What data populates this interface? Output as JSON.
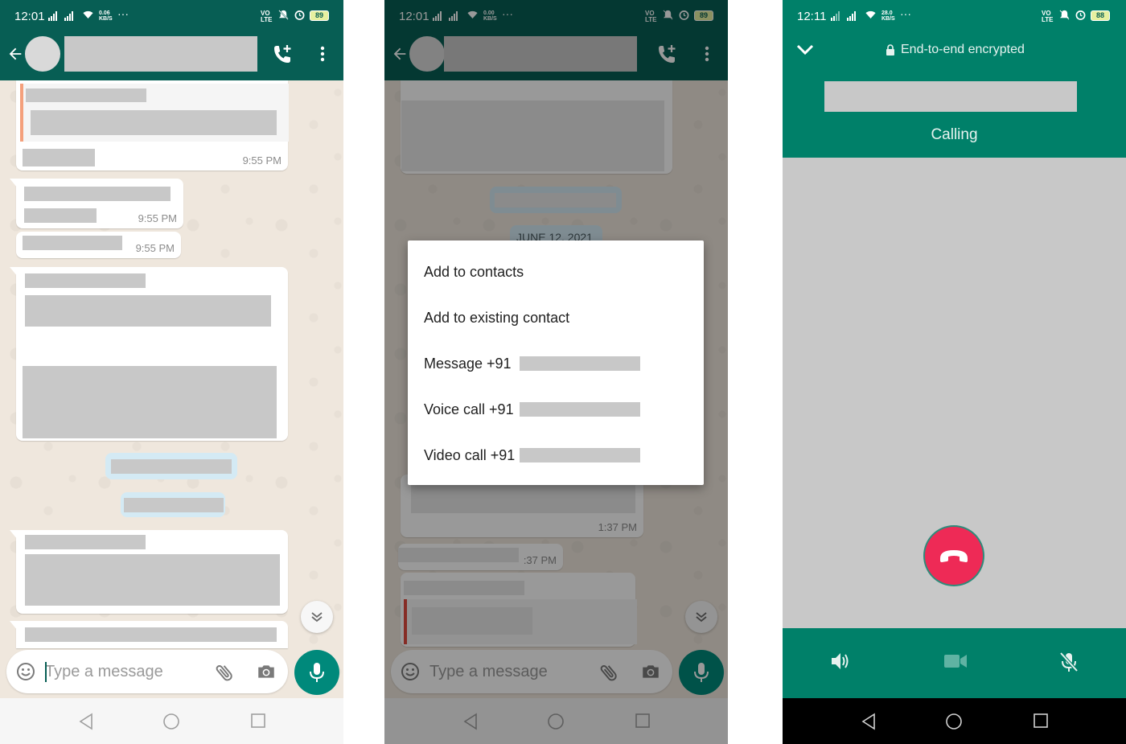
{
  "status": {
    "p1": {
      "time": "12:01",
      "kbs_top": "0.06",
      "kbs_bottom": "KB/S",
      "volte_top": "VO",
      "volte_bottom": "LTE",
      "battery": "89",
      "more": "···"
    },
    "p2": {
      "time": "12:01",
      "kbs_top": "0.00",
      "kbs_bottom": "KB/S",
      "volte_top": "VO",
      "volte_bottom": "LTE",
      "battery": "89",
      "more": "···"
    },
    "p3": {
      "time": "12:11",
      "kbs_top": "28.0",
      "kbs_bottom": "KB/S",
      "volte_top": "VO",
      "volte_bottom": "LTE",
      "battery": "88",
      "more": "···"
    }
  },
  "chat": {
    "times": [
      "9:55 PM",
      "9:55 PM",
      "9:55 PM"
    ],
    "composer_placeholder": "Type a message",
    "p2_times": [
      "1:37 PM",
      ":37 PM"
    ],
    "date_label": "JUNE 12, 2021"
  },
  "menu": {
    "items": [
      "Add to contacts",
      "Add to existing contact",
      "Message +91",
      "Voice call +91",
      "Video call +91"
    ]
  },
  "call": {
    "encrypted": "End-to-end encrypted",
    "status": "Calling"
  },
  "colors": {
    "header": "#075e54",
    "call_header": "#008069",
    "fab": "#00897b",
    "end_call": "#ee2a56"
  }
}
